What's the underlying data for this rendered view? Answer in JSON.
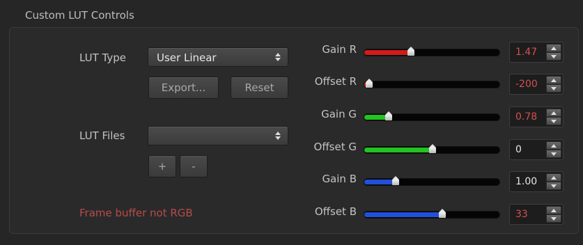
{
  "panel": {
    "title": "Custom LUT Controls"
  },
  "lut_type": {
    "label": "LUT Type",
    "selected": "User Linear"
  },
  "buttons": {
    "export": "Export...",
    "reset": "Reset",
    "add": "+",
    "remove": "-"
  },
  "lut_files": {
    "label": "LUT Files",
    "selected": ""
  },
  "status": {
    "message": "Frame buffer not RGB",
    "color": "#b84b4b"
  },
  "sliders": [
    {
      "label": "Gain R",
      "value": "1.47",
      "level": 0.34,
      "color": "#d21b1b",
      "value_color": "#d45050"
    },
    {
      "label": "Offset R",
      "value": "-200",
      "level": 0.02,
      "color": "#d21b1b",
      "value_color": "#d45050"
    },
    {
      "label": "Gain G",
      "value": "0.78",
      "level": 0.18,
      "color": "#22c322",
      "value_color": "#d45050"
    },
    {
      "label": "Offset G",
      "value": "0",
      "level": 0.5,
      "color": "#22c322",
      "value_color": "#e6e6e6"
    },
    {
      "label": "Gain B",
      "value": "1.00",
      "level": 0.23,
      "color": "#2250d8",
      "value_color": "#e6e6e6"
    },
    {
      "label": "Offset B",
      "value": "33",
      "level": 0.57,
      "color": "#2250d8",
      "value_color": "#d45050"
    }
  ]
}
